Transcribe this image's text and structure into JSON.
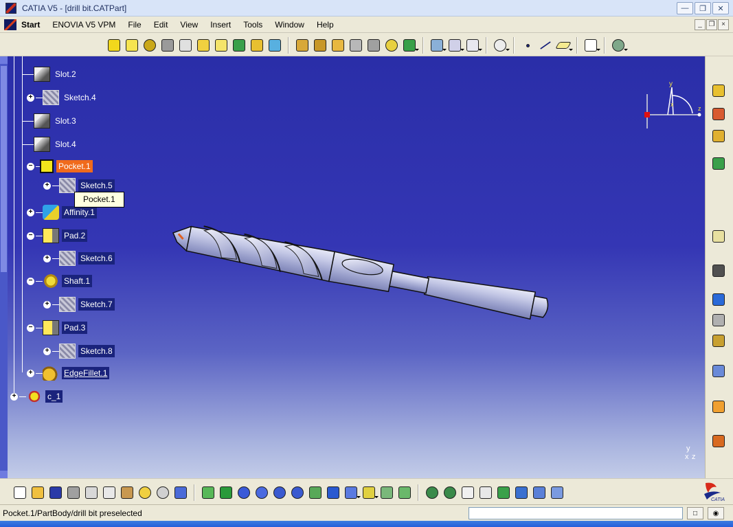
{
  "window": {
    "title": "CATIA V5 - [drill bit.CATPart]",
    "buttons": [
      "—",
      "❐",
      "✕"
    ]
  },
  "menubar": {
    "items": [
      "Start",
      "ENOVIA V5 VPM",
      "File",
      "Edit",
      "View",
      "Insert",
      "Tools",
      "Window",
      "Help"
    ],
    "mdi_buttons": [
      "_",
      "❐",
      "×"
    ]
  },
  "tree": {
    "items": [
      {
        "label": "Slot.2",
        "icon": "slot-icon"
      },
      {
        "label": "Sketch.4",
        "icon": "sketch-icon"
      },
      {
        "label": "Slot.3",
        "icon": "slot-icon"
      },
      {
        "label": "Slot.4",
        "icon": "slot-icon"
      },
      {
        "label": "Pocket.1",
        "icon": "pocket-icon",
        "selected": true
      },
      {
        "label": "Sketch.5",
        "icon": "sketch-icon"
      },
      {
        "label": "Affinity.1",
        "icon": "affinity-icon"
      },
      {
        "label": "Pad.2",
        "icon": "pad-icon"
      },
      {
        "label": "Sketch.6",
        "icon": "sketch-icon"
      },
      {
        "label": "Shaft.1",
        "icon": "shaft-icon"
      },
      {
        "label": "Sketch.7",
        "icon": "sketch-icon"
      },
      {
        "label": "Pad.3",
        "icon": "pad-icon"
      },
      {
        "label": "Sketch.8",
        "icon": "sketch-icon"
      },
      {
        "label": "EdgeFillet.1",
        "icon": "edge-fillet-icon"
      },
      {
        "label": "c_1",
        "icon": "geometrical-set-icon"
      }
    ]
  },
  "tooltip": "Pocket.1",
  "compass": {
    "x": "x",
    "y": "y",
    "z": "z"
  },
  "axis_indicator": {
    "y": "y",
    "x": "x",
    "z": "z"
  },
  "bottom_logo": "CATIA",
  "status": {
    "text": "Pocket.1/PartBody/drill bit preselected",
    "command_value": ""
  },
  "colors": {
    "viewport_top": "#2a2ea8",
    "viewport_bottom": "#c3cce8",
    "selection": "#F06A1C",
    "tooltip_bg": "#FFFFE1"
  }
}
